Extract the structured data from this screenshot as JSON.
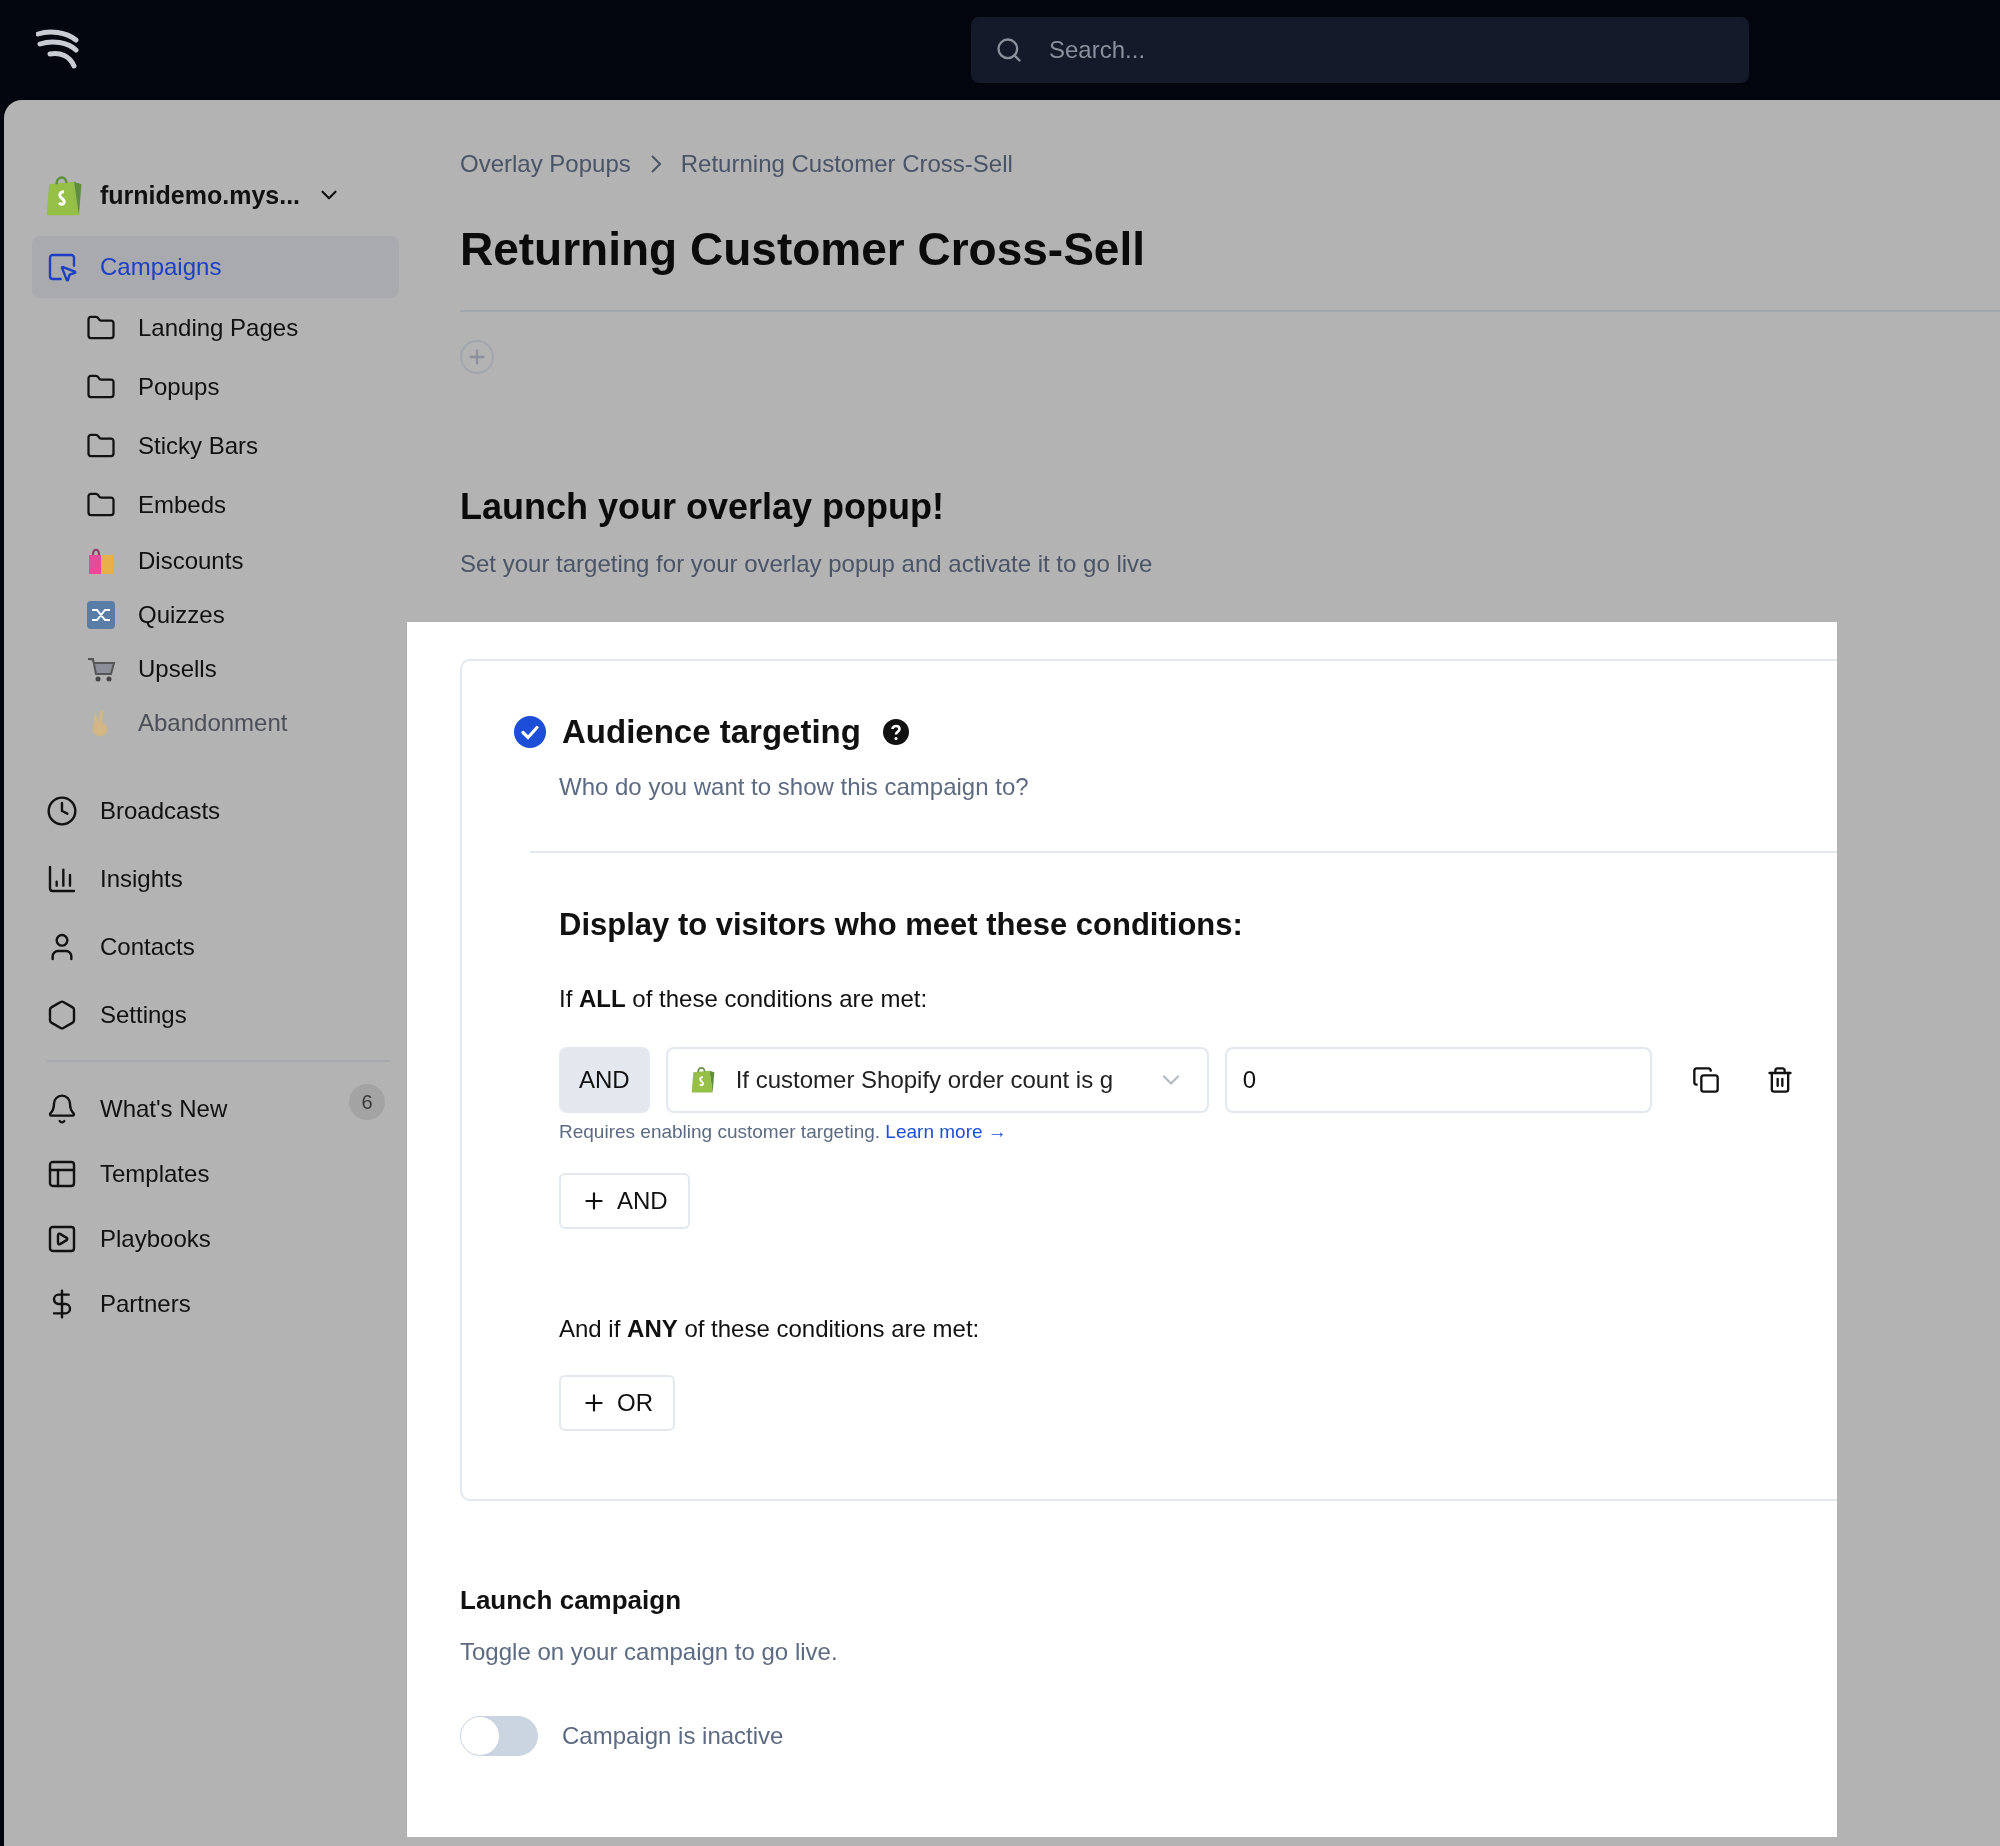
{
  "topbar": {
    "search": {
      "placeholder": "Search..."
    }
  },
  "sidebar": {
    "store": "furnidemo.mys...",
    "items": [
      {
        "label": "Campaigns",
        "selected": true,
        "children": [
          {
            "label": "Landing Pages",
            "disabled": false
          },
          {
            "label": "Popups",
            "disabled": false
          },
          {
            "label": "Sticky Bars",
            "disabled": false
          },
          {
            "label": "Embeds",
            "disabled": false
          },
          {
            "label": "Discounts",
            "disabled": false
          },
          {
            "label": "Quizzes",
            "disabled": false
          },
          {
            "label": "Upsells",
            "disabled": false
          },
          {
            "label": "Abandonment",
            "disabled": true
          }
        ]
      },
      {
        "label": "Broadcasts",
        "selected": false
      },
      {
        "label": "Insights",
        "selected": false
      },
      {
        "label": "Contacts",
        "selected": false
      },
      {
        "label": "Settings",
        "selected": false
      }
    ],
    "footer_items": [
      {
        "label": "What's New",
        "badge": "6"
      },
      {
        "label": "Templates"
      },
      {
        "label": "Playbooks"
      },
      {
        "label": "Partners"
      }
    ]
  },
  "breadcrumb": [
    "Overlay Popups",
    "Returning Customer Cross-Sell"
  ],
  "title": "Returning Customer Cross-Sell",
  "launch_intro": {
    "heading": "Launch your overlay popup!",
    "subtitle": "Set your targeting for your overlay popup and activate it to go live"
  },
  "audience": {
    "completed": true,
    "title": "Audience targeting",
    "subtitle": "Who do you want to show this campaign to?",
    "conditions_heading": "Display to visitors who meet these conditions:",
    "all_label": "If **ALL** of these conditions are met:",
    "conditions": [
      {
        "operator": "AND",
        "field": "If customer Shopify order count is g",
        "value": "0"
      }
    ],
    "helper": "Requires enabling customer targeting.",
    "helper_link": "Learn more →",
    "add_and": "AND",
    "any_label": "And if **ANY** of these conditions are met:",
    "add_or": "OR"
  },
  "launch": {
    "heading": "Launch campaign",
    "subtitle": "Toggle on your campaign to go live.",
    "toggle": {
      "on": false,
      "label": "Campaign is inactive"
    }
  }
}
